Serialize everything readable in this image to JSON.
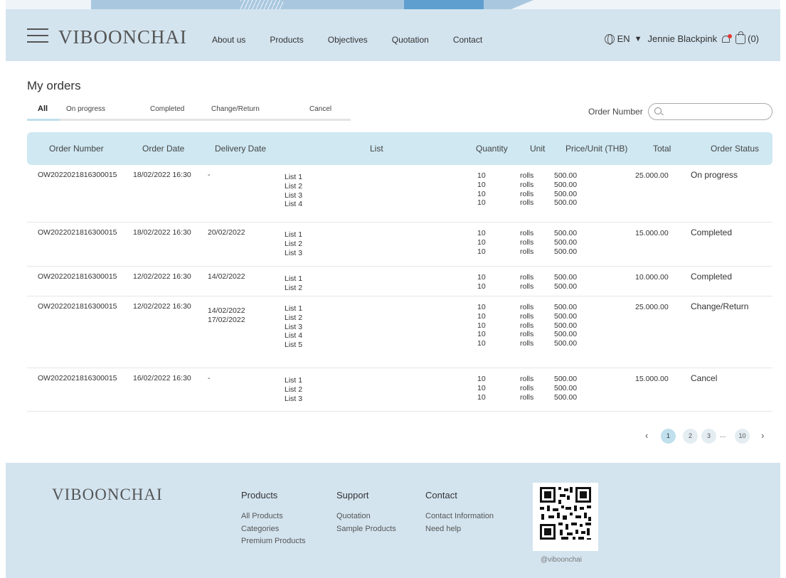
{
  "header": {
    "logo": "VIBOONCHAI",
    "nav": [
      "About us",
      "Products",
      "Objectives",
      "Quotation",
      "Contact"
    ],
    "language": "EN",
    "user_name": "Jennie Blackpink",
    "cart_count": "(0)"
  },
  "page": {
    "title": "My orders",
    "tabs": [
      "All",
      "On progress",
      "Completed",
      "Change/Return",
      "Cancel"
    ],
    "active_tab": "All",
    "order_number_label": "Order Number",
    "search_placeholder": ""
  },
  "table": {
    "headers": [
      "Order Number",
      "Order Date",
      "Delivery Date",
      "List",
      "Quantity",
      "Unit",
      "Price/Unit (THB)",
      "Total",
      "Order Status"
    ],
    "rows": [
      {
        "order_number": "OW2022021816300015",
        "order_date": "18/02/2022 16:30",
        "delivery_dates": [
          "-"
        ],
        "lists": [
          "List 1",
          "List 2",
          "List 3",
          "List 4"
        ],
        "quantities": [
          "10",
          "10",
          "10",
          "10"
        ],
        "units": [
          "rolls",
          "rolls",
          "rolls",
          "rolls"
        ],
        "prices": [
          "500.00",
          "500.00",
          "500.00",
          "500.00"
        ],
        "total": "25.000.00",
        "status": "On progress"
      },
      {
        "order_number": "OW2022021816300015",
        "order_date": "18/02/2022 16:30",
        "delivery_dates": [
          "20/02/2022"
        ],
        "lists": [
          "List 1",
          "List 2",
          "List 3"
        ],
        "quantities": [
          "10",
          "10",
          "10"
        ],
        "units": [
          "rolls",
          "rolls",
          "rolls"
        ],
        "prices": [
          "500.00",
          "500.00",
          "500.00"
        ],
        "total": "15.000.00",
        "status": "Completed"
      },
      {
        "order_number": "OW2022021816300015",
        "order_date": "12/02/2022 16:30",
        "delivery_dates": [
          "14/02/2022"
        ],
        "lists": [
          "List 1",
          "List 2"
        ],
        "quantities": [
          "10",
          "10"
        ],
        "units": [
          "rolls",
          "rolls"
        ],
        "prices": [
          "500.00",
          "500.00"
        ],
        "total": "10.000.00",
        "status": "Completed"
      },
      {
        "order_number": "OW2022021816300015",
        "order_date": "12/02/2022 16:30",
        "delivery_dates": [
          "14/02/2022",
          "17/02/2022"
        ],
        "lists": [
          "List 1",
          "List 2",
          "List 3",
          "List 4",
          "List 5"
        ],
        "quantities": [
          "10",
          "10",
          "10",
          "10",
          "10"
        ],
        "units": [
          "rolls",
          "rolls",
          "rolls",
          "rolls",
          "rolls"
        ],
        "prices": [
          "500.00",
          "500.00",
          "500.00",
          "500.00",
          "500.00"
        ],
        "total": "25.000.00",
        "status": "Change/Return"
      },
      {
        "order_number": "OW2022021816300015",
        "order_date": "16/02/2022 16:30",
        "delivery_dates": [
          "-"
        ],
        "lists": [
          "List 1",
          "List 2",
          "List 3"
        ],
        "quantities": [
          "10",
          "10",
          "10"
        ],
        "units": [
          "rolls",
          "rolls",
          "rolls"
        ],
        "prices": [
          "500.00",
          "500.00",
          "500.00"
        ],
        "total": "15.000.00",
        "status": "Cancel"
      }
    ]
  },
  "pagination": {
    "prev": "‹",
    "next": "›",
    "pages": [
      "1",
      "2",
      "3",
      "10"
    ],
    "ellipsis": "...",
    "current": "1"
  },
  "footer": {
    "logo": "VIBOONCHAI",
    "columns": [
      {
        "title": "Products",
        "links": [
          "All Products",
          "Categories",
          "Premium Products"
        ]
      },
      {
        "title": "Support",
        "links": [
          "Quotation",
          "Sample Products"
        ]
      },
      {
        "title": "Contact",
        "links": [
          "Contact Information",
          "Need help"
        ]
      }
    ],
    "qr_handle": "@viboonchai"
  },
  "icons": {
    "menu": "hamburger-menu-icon",
    "language": "globe-icon",
    "dropdown": "caret-down-icon",
    "notifications": "bell-icon",
    "cart": "shopping-bag-icon",
    "search": "search-icon"
  },
  "colors": {
    "header_bg": "#d3e4ef",
    "table_header_bg": "#cfe8f2",
    "active_accent": "#bfe0ec",
    "notification_dot": "#e53935"
  }
}
